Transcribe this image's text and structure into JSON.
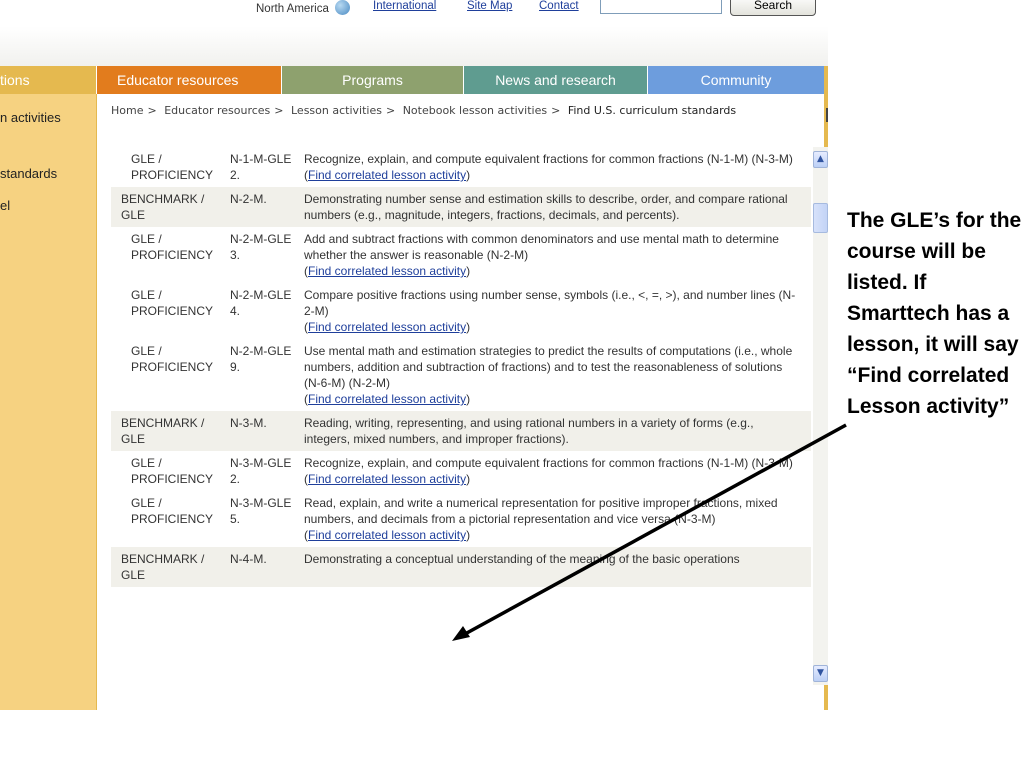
{
  "header": {
    "region": "North America",
    "links": [
      "International",
      "Site Map",
      "Contact"
    ],
    "search_value": "",
    "search_button": "Search"
  },
  "nav": {
    "tabs": [
      "tions",
      "Educator resources",
      "Programs",
      "News and research",
      "Community"
    ],
    "active": "Educator resources"
  },
  "sidebar": {
    "items": [
      "n activities",
      "standards",
      "el"
    ]
  },
  "breadcrumb": {
    "items": [
      "Home",
      "Educator resources",
      "Lesson activities",
      "Notebook lesson activities"
    ],
    "current": "Find U.S. curriculum standards",
    "separator": ">"
  },
  "standards": [
    {
      "kind": "gle",
      "type": "GLE / PROFICIENCY",
      "code": "N-1-M-GLE 2.",
      "desc": "Recognize, explain, and compute equivalent fractions for common fractions (N-1-M) (N-3-M)",
      "link": "Find correlated lesson activity"
    },
    {
      "kind": "bm",
      "type": "BENCHMARK / GLE",
      "code": "N-2-M.",
      "desc": "Demonstrating number sense and estimation skills to describe, order, and compare rational numbers (e.g., magnitude, integers, fractions, decimals, and percents).",
      "link": ""
    },
    {
      "kind": "gle",
      "type": "GLE / PROFICIENCY",
      "code": "N-2-M-GLE 3.",
      "desc": "Add and subtract fractions with common denominators and use mental math to determine whether the answer is reasonable (N-2-M)",
      "link": "Find correlated lesson activity"
    },
    {
      "kind": "gle",
      "type": "GLE / PROFICIENCY",
      "code": "N-2-M-GLE 4.",
      "desc": "Compare positive fractions using number sense, symbols (i.e., <, =, >), and number lines (N-2-M)",
      "link": "Find correlated lesson activity"
    },
    {
      "kind": "gle",
      "type": "GLE / PROFICIENCY",
      "code": "N-2-M-GLE 9.",
      "desc": "Use mental math and estimation strategies to predict the results of computations (i.e., whole numbers, addition and subtraction of fractions) and to test the reasonableness of solutions (N-6-M) (N-2-M)",
      "link": "Find correlated lesson activity"
    },
    {
      "kind": "bm",
      "type": "BENCHMARK / GLE",
      "code": "N-3-M.",
      "desc": "Reading, writing, representing, and using rational numbers in a variety of forms (e.g., integers, mixed numbers, and improper fractions).",
      "link": ""
    },
    {
      "kind": "gle",
      "type": "GLE / PROFICIENCY",
      "code": "N-3-M-GLE 2.",
      "desc": "Recognize, explain, and compute equivalent fractions for common fractions (N-1-M) (N-3-M)",
      "link": "Find correlated lesson activity"
    },
    {
      "kind": "gle",
      "type": "GLE / PROFICIENCY",
      "code": "N-3-M-GLE 5.",
      "desc": "Read, explain, and write a numerical representation for positive improper fractions, mixed numbers, and decimals from a pictorial representation and vice versa (N-3-M)",
      "link": "Find correlated lesson activity"
    },
    {
      "kind": "bm",
      "type": "BENCHMARK / GLE",
      "code": "N-4-M.",
      "desc": "Demonstrating a conceptual understanding of the meaning of the basic operations",
      "link": ""
    }
  ],
  "annotation": {
    "text": "The GLE’s for the course will be listed. If Smarttech has a lesson, it will say “Find correlated Lesson activity”"
  }
}
